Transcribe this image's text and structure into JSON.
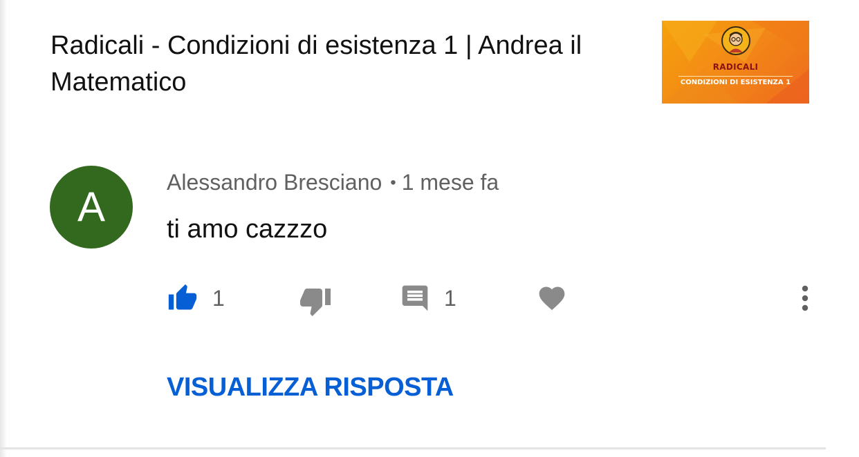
{
  "video": {
    "title": "Radicali - Condizioni di esistenza 1 | Andrea il Matematico",
    "thumbnail": {
      "title": "RADICALI",
      "subtitle": "CONDIZIONI DI ESISTENZA 1",
      "background": "#f39a14"
    }
  },
  "comment": {
    "avatar_letter": "A",
    "avatar_color": "#33691e",
    "author": "Alessandro Bresciano",
    "separator": "•",
    "time": "1 mese fa",
    "text": "ti amo cazzzo",
    "likes": "1",
    "replies": "1"
  },
  "actions": {
    "like_icon": "thumb-up-icon",
    "dislike_icon": "thumb-down-icon",
    "reply_icon": "comment-icon",
    "heart_icon": "heart-icon",
    "more_icon": "more-vertical-icon",
    "accent_color": "#065fd4"
  },
  "view_replies_label": "VISUALIZZA RISPOSTA"
}
